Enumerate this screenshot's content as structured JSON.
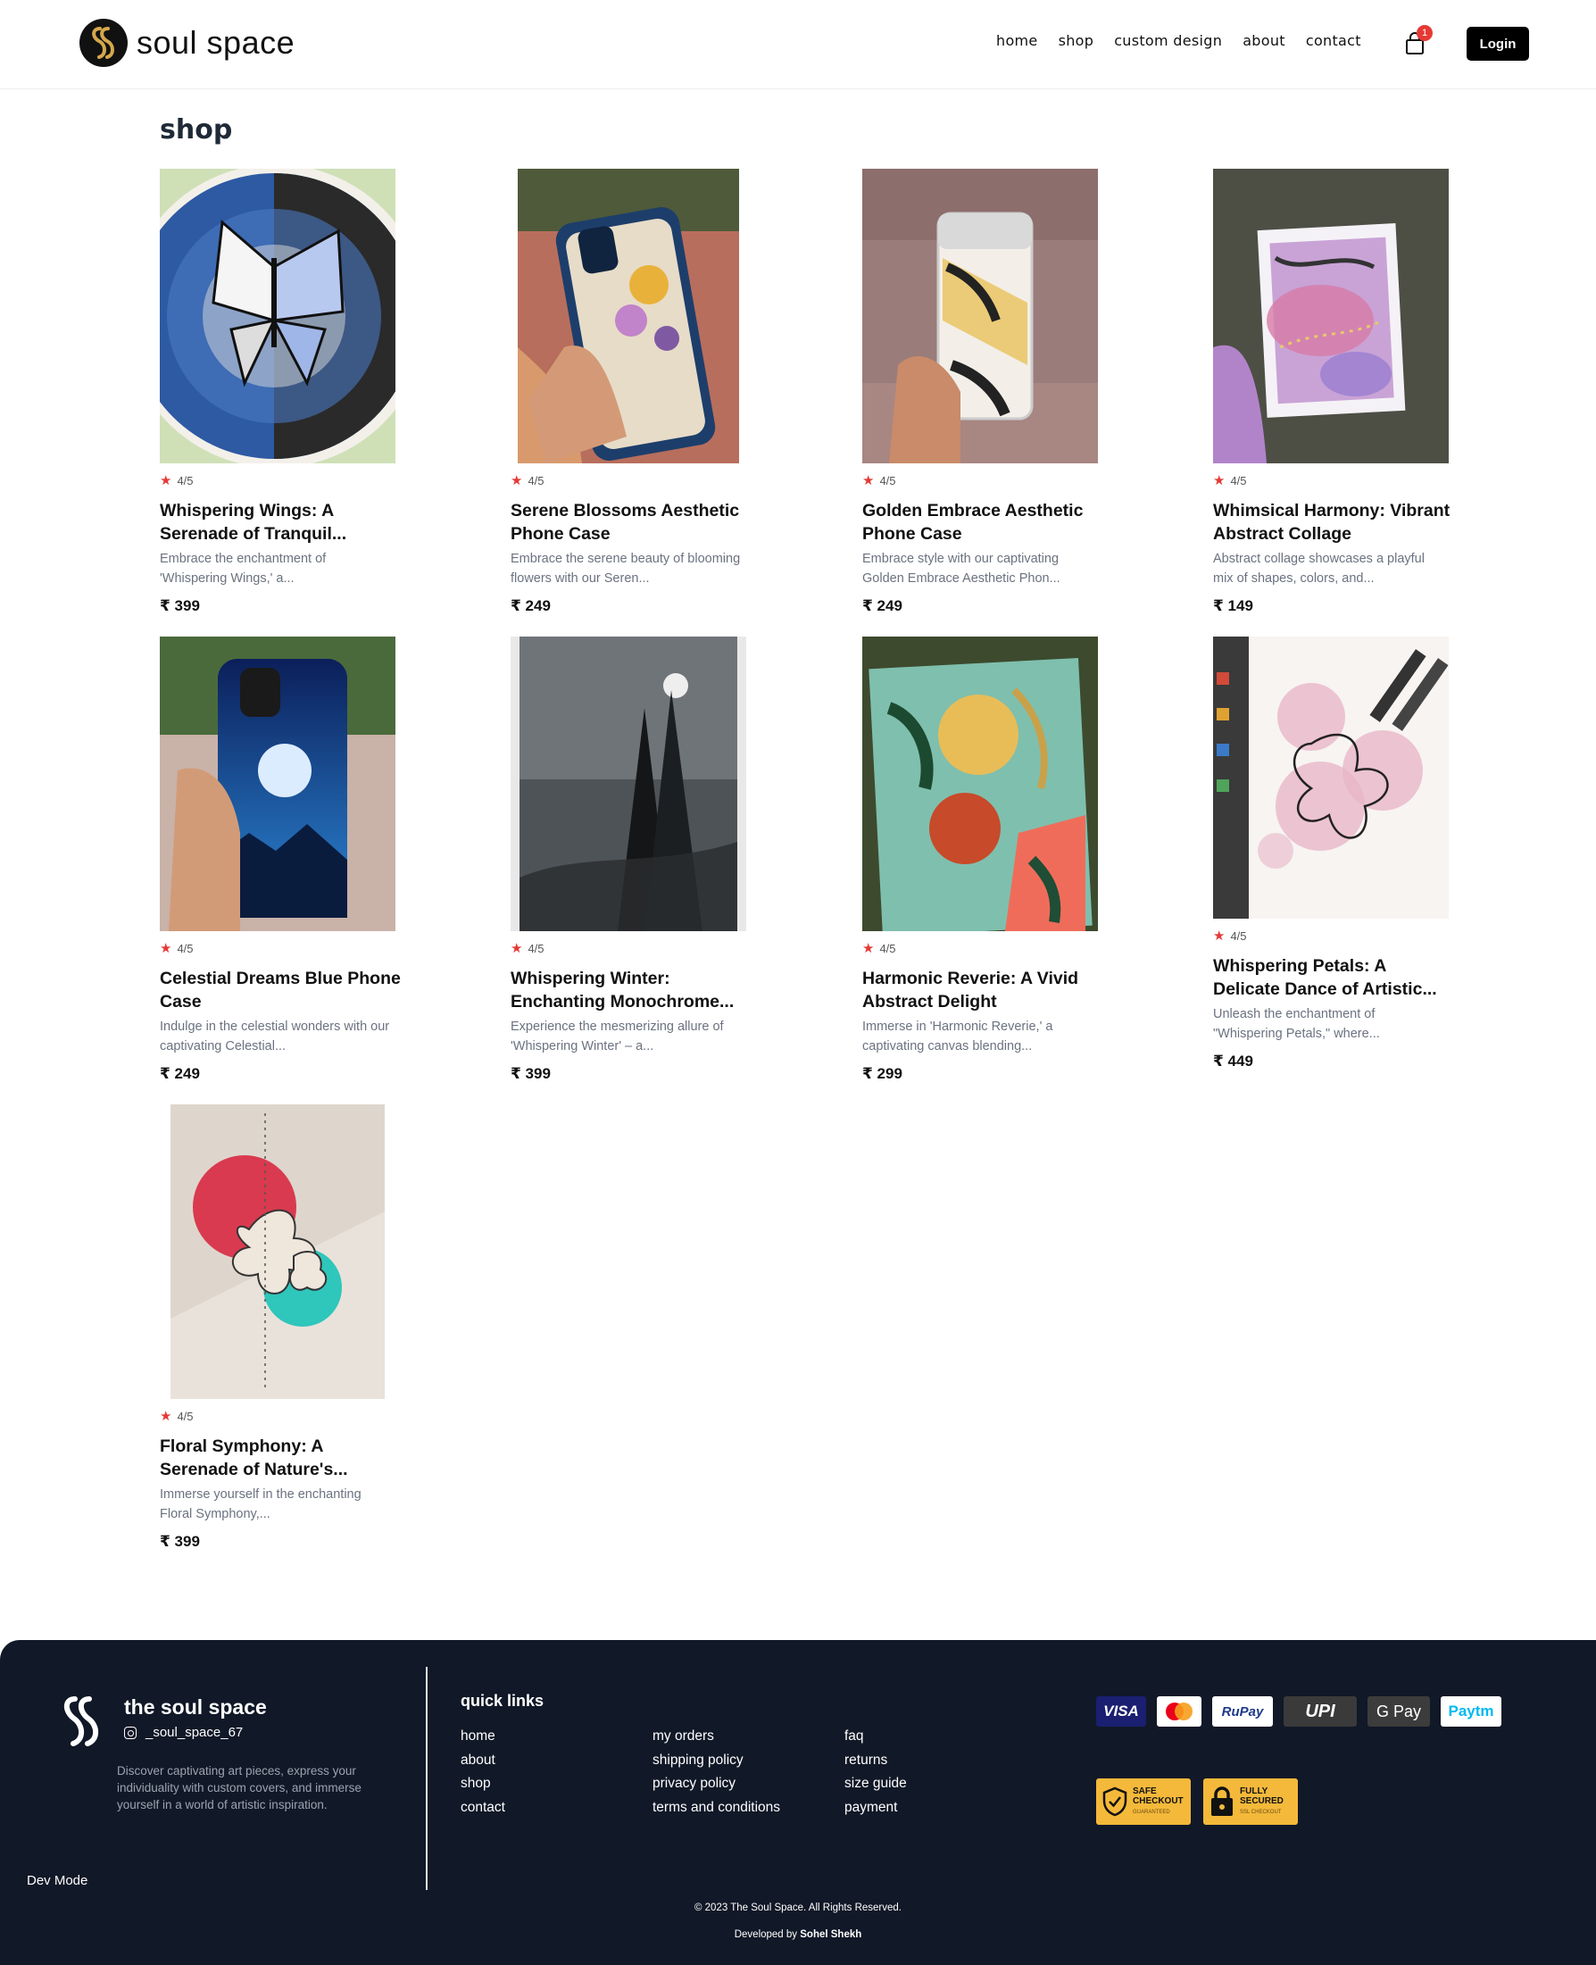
{
  "header": {
    "brand": "soul space",
    "nav": [
      "home",
      "shop",
      "custom design",
      "about",
      "contact"
    ],
    "cart_count": "1",
    "login_label": "Login"
  },
  "main": {
    "title": "shop",
    "products": [
      {
        "rating": "4/5",
        "title": "Whispering Wings: A Serenade of Tranquil...",
        "desc": "Embrace the enchantment of 'Whispering Wings,' a...",
        "price": "₹ 399"
      },
      {
        "rating": "4/5",
        "title": "Serene Blossoms Aesthetic Phone Case",
        "desc": "Embrace the serene beauty of blooming flowers with our Seren...",
        "price": "₹ 249"
      },
      {
        "rating": "4/5",
        "title": "Golden Embrace Aesthetic Phone Case",
        "desc": "Embrace style with our captivating Golden Embrace Aesthetic Phon...",
        "price": "₹ 249"
      },
      {
        "rating": "4/5",
        "title": "Whimsical Harmony: Vibrant Abstract Collage",
        "desc": "Abstract collage showcases a playful mix of shapes, colors, and...",
        "price": "₹ 149"
      },
      {
        "rating": "4/5",
        "title": "Celestial Dreams Blue Phone Case",
        "desc": "Indulge in the celestial wonders with our captivating Celestial...",
        "price": "₹ 249"
      },
      {
        "rating": "4/5",
        "title": "Whispering Winter: Enchanting Monochrome...",
        "desc": "Experience the mesmerizing allure of 'Whispering Winter' – a...",
        "price": "₹ 399"
      },
      {
        "rating": "4/5",
        "title": "Harmonic Reverie: A Vivid Abstract Delight",
        "desc": "Immerse in 'Harmonic Reverie,' a captivating canvas blending...",
        "price": "₹ 299"
      },
      {
        "rating": "4/5",
        "title": "Whispering Petals: A Delicate Dance of Artistic...",
        "desc": "Unleash the enchantment of \"Whispering Petals,\" where...",
        "price": "₹ 449"
      },
      {
        "rating": "4/5",
        "title": "Floral Symphony: A Serenade of Nature's...",
        "desc": "Immerse yourself in the enchanting Floral Symphony,...",
        "price": "₹ 399"
      }
    ]
  },
  "footer": {
    "brand": "the soul space",
    "instagram": "_soul_space_67",
    "about": "Discover captivating art pieces, express your individuality with custom covers, and immerse yourself in a world of artistic inspiration.",
    "quick_links_title": "quick links",
    "col1": [
      "home",
      "about",
      "shop",
      "contact"
    ],
    "col2": [
      "my orders",
      "shipping policy",
      "privacy policy",
      "terms and conditions"
    ],
    "col3": [
      "faq",
      "returns",
      "size guide",
      "payment"
    ],
    "payments": [
      "VISA",
      "Mastercard",
      "RuPay",
      "UPI",
      "G Pay",
      "Paytm"
    ],
    "badges": [
      {
        "line1": "SAFE",
        "line2": "CHECKOUT",
        "line3": "GUARANTEED"
      },
      {
        "line1": "FULLY",
        "line2": "SECURED",
        "line3": "SSL CHECKOUT"
      }
    ],
    "dev_mode": "Dev Mode",
    "copyright": "© 2023 The Soul Space. All Rights Reserved.",
    "developed_prefix": "Developed by",
    "developer": "Sohel Shekh"
  }
}
